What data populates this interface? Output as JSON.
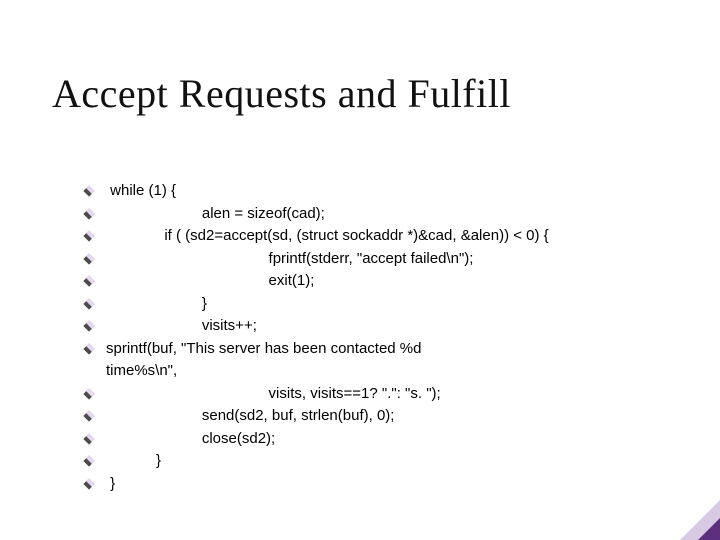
{
  "title": "Accept Requests and Fulfill",
  "lines": [
    " while (1) {",
    "                       alen = sizeof(cad);",
    "              if ( (sd2=accept(sd, (struct sockaddr *)&cad, &alen)) < 0) {",
    "                                       fprintf(stderr, \"accept failed\\n\");",
    "                                       exit(1);",
    "                       }",
    "                       visits++;",
    "                       sprintf(buf, \"This server has been contacted %d",
    "time%s\\n\",",
    "                                       visits, visits==1? \".\": \"s. \");",
    "                       send(sd2, buf, strlen(buf), 0);",
    "                       close(sd2);",
    "            }",
    " }"
  ]
}
